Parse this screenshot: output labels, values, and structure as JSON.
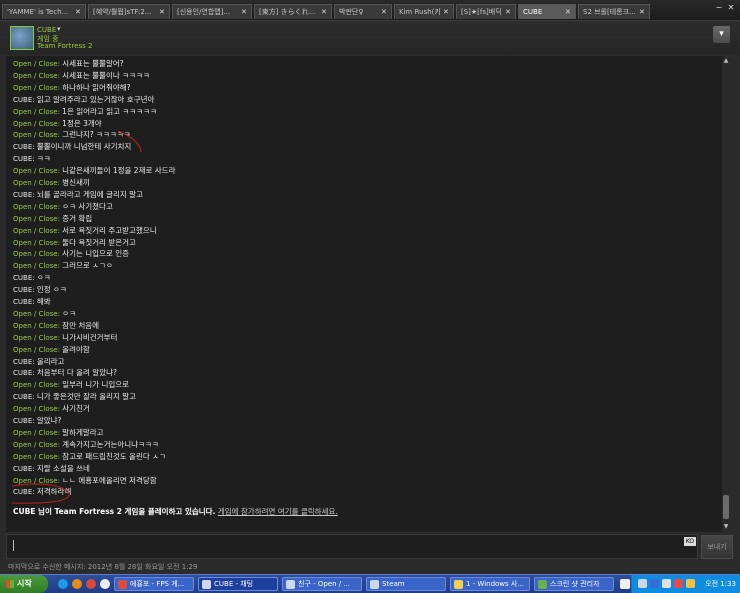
{
  "tabs": [
    {
      "label": "'YAMME' is Tech...",
      "active": false
    },
    {
      "label": "[혜약/뿔뭡]sTF:2...",
      "active": false
    },
    {
      "label": "[신용인/연합맵]...",
      "active": false
    },
    {
      "label": "[東方] きらくれ...",
      "active": false
    },
    {
      "label": "박판단♀",
      "active": false
    },
    {
      "label": "Kim Rush(키웃...",
      "active": false
    },
    {
      "label": "[S]★[fs]배딕",
      "active": false
    },
    {
      "label": "CUBE",
      "active": true
    },
    {
      "label": "S2 브롤[테롱크...",
      "active": false
    }
  ],
  "header": {
    "friend_name": "CUBE",
    "status": "게임 중",
    "game": "Team Fortress 2"
  },
  "messages": [
    {
      "name": "Open / Close",
      "text": "시세표는 뿔뿔알어?",
      "who": "open"
    },
    {
      "name": "Open / Close",
      "text": "시세표는 뿔뿔이나 ㅋㅋㅋㅋ",
      "who": "open"
    },
    {
      "name": "Open / Close",
      "text": "하나하나 읽어줘야해?",
      "who": "open"
    },
    {
      "name": "CUBE",
      "text": "읽고 알려주라고 있는거잖아 호구년아",
      "who": "cube"
    },
    {
      "name": "Open / Close",
      "text": "1은 읽어라고 읽고 ㅋㅋㅋㅋㅋ",
      "who": "open"
    },
    {
      "name": "Open / Close",
      "text": "1정은 3개야",
      "who": "open"
    },
    {
      "name": "Open / Close",
      "text": "그런냐지? ㅋㅋㅋㅋㅋ",
      "who": "open"
    },
    {
      "name": "CUBE",
      "text": "뿔뿔이니까 니넘한테 사기치지",
      "who": "cube"
    },
    {
      "name": "CUBE",
      "text": "ㅋㅋ",
      "who": "cube"
    },
    {
      "name": "Open / Close",
      "text": "니같은새끼들이 1정을 2재로 사드라",
      "who": "open"
    },
    {
      "name": "Open / Close",
      "text": "병신새끼",
      "who": "open"
    },
    {
      "name": "CUBE",
      "text": "뇌를 골라라고 게임에 글리지 말고",
      "who": "cube"
    },
    {
      "name": "Open / Close",
      "text": "ㅇㅋ 사기쳤다고",
      "who": "open"
    },
    {
      "name": "Open / Close",
      "text": "증거 확립",
      "who": "open"
    },
    {
      "name": "Open / Close",
      "text": "서로 욕짓거리 주고받고했으니",
      "who": "open"
    },
    {
      "name": "Open / Close",
      "text": "둘다 욕짓거리 받은거고",
      "who": "open"
    },
    {
      "name": "Open / Close",
      "text": "사기는 니입으로 인증",
      "who": "open"
    },
    {
      "name": "Open / Close",
      "text": "그러므로 ㅅㄱㅇ",
      "who": "open"
    },
    {
      "name": "CUBE",
      "text": "ㅇㅋ",
      "who": "cube"
    },
    {
      "name": "CUBE",
      "text": "인정 ㅇㅋ",
      "who": "cube"
    },
    {
      "name": "CUBE",
      "text": "해봐",
      "who": "cube"
    },
    {
      "name": "Open / Close",
      "text": "ㅇㅋ",
      "who": "open"
    },
    {
      "name": "Open / Close",
      "text": "잠만 처음에",
      "who": "open"
    },
    {
      "name": "Open / Close",
      "text": "니가시비건거부터",
      "who": "open"
    },
    {
      "name": "Open / Close",
      "text": "올려야함",
      "who": "open"
    },
    {
      "name": "CUBE",
      "text": "올리라고",
      "who": "cube"
    },
    {
      "name": "CUBE",
      "text": "처음부터 다 올려 알았냐?",
      "who": "cube"
    },
    {
      "name": "Open / Close",
      "text": "일부러 니가 니입으로",
      "who": "open"
    },
    {
      "name": "CUBE",
      "text": "니가 좋은것만 잘라 올리지 말고",
      "who": "cube"
    },
    {
      "name": "Open / Close",
      "text": "사기친거",
      "who": "open"
    },
    {
      "name": "CUBE",
      "text": "알았냐?",
      "who": "cube"
    },
    {
      "name": "Open / Close",
      "text": "말하게말라고",
      "who": "open"
    },
    {
      "name": "Open / Close",
      "text": "계속가지고논거는아니냐ㅋㅋㅋ",
      "who": "open"
    },
    {
      "name": "Open / Close",
      "text": "참고로 패드립친것도 올린다 ㅅㄱ",
      "who": "open"
    },
    {
      "name": "CUBE",
      "text": "지랄 소설을 쓰네",
      "who": "cube"
    },
    {
      "name": "Open / Close",
      "text": "ㄴㄴ 에횽포에올리면 저격당함",
      "who": "open"
    },
    {
      "name": "CUBE",
      "text": "저격하라해",
      "who": "cube"
    }
  ],
  "system_message": {
    "bold": "CUBE 님이 Team Fortress 2 게임을 플레이하고 있습니다.",
    "link": "게임에 참가하려면 여기를 클릭하세요."
  },
  "input": {
    "value": "",
    "ime": "KO",
    "send_label": "보내기"
  },
  "last_received": "마지막으로 수신한 메시지: 2012년 8월 28일 화요일 오전 1:29",
  "taskbar": {
    "start_label": "시작",
    "tasks": [
      {
        "label": "에횽포 - FPS 게...",
        "active": false
      },
      {
        "label": "CUBE - 채팅",
        "active": true
      },
      {
        "label": "친구 - Open / ...",
        "active": false
      },
      {
        "label": "Steam",
        "active": false
      },
      {
        "label": "1 - Windows 사...",
        "active": false
      },
      {
        "label": "스크린 샷 관리자",
        "active": false
      }
    ],
    "clock": "오전 1:33"
  },
  "colors": {
    "open_name": "#9acb4a",
    "background": "#1e1e1e",
    "accent_green": "#8cc83c"
  }
}
